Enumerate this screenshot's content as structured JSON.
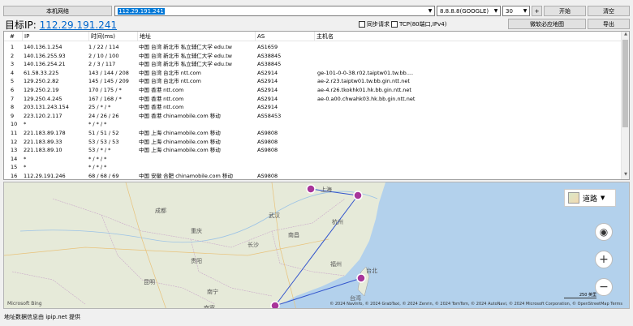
{
  "toolbar": {
    "local_network_label": "本机网络",
    "ip_value": "112.29.191.241",
    "dns_value": "8.8.8.8(GOOGLE)",
    "count_value": "30",
    "plus_label": "+",
    "start_label": "开始",
    "clear_label": "清空",
    "sync_request_label": "同步请求",
    "tcp_label": "TCP(80端口,IPv4)",
    "bing_map_label": "微软必应地图",
    "export_label": "导出"
  },
  "target": {
    "prefix": "目标IP:",
    "ip": "112.29.191.241"
  },
  "table": {
    "headers": [
      "#",
      "IP",
      "时间(ms)",
      "地址",
      "AS",
      "主机名"
    ],
    "rows": [
      [
        "1",
        "140.136.1.254",
        "1 / 22 / 114",
        "中国 台湾 新北市 私立辅仁大学 edu.tw",
        "AS1659",
        ""
      ],
      [
        "2",
        "140.136.255.93",
        "2 / 10 / 100",
        "中国 台湾 新北市 私立辅仁大学 edu.tw",
        "AS38845",
        ""
      ],
      [
        "3",
        "140.136.254.21",
        "2 / 3 / 117",
        "中国 台湾 新北市 私立辅仁大学 edu.tw",
        "AS38845",
        ""
      ],
      [
        "4",
        "61.58.33.225",
        "143 / 144 / 208",
        "中国 台湾 台北市 ntt.com",
        "AS2914",
        "ge-101-0-0-38.r02.taiptw01.tw.bb...."
      ],
      [
        "5",
        "129.250.2.82",
        "145 / 145 / 209",
        "中国 台湾 台北市 ntt.com",
        "AS2914",
        "ae-2.r23.taiptw01.tw.bb.gin.ntt.net"
      ],
      [
        "6",
        "129.250.2.19",
        "170 / 175 / *",
        "中国 香港 ntt.com",
        "AS2914",
        "ae-4.r26.tkokhk01.hk.bb.gin.ntt.net"
      ],
      [
        "7",
        "129.250.4.245",
        "167 / 168 / *",
        "中国 香港 ntt.com",
        "AS2914",
        "ae-0.a00.chwahk03.hk.bb.gin.ntt.net"
      ],
      [
        "8",
        "203.131.243.154",
        "25 / * / *",
        "中国 香港 ntt.com",
        "AS2914",
        ""
      ],
      [
        "9",
        "223.120.2.117",
        "24 / 26 / 26",
        "中国 香港 chinamobile.com 移动",
        "AS58453",
        ""
      ],
      [
        "10",
        "*",
        "* / * / *",
        "",
        "",
        ""
      ],
      [
        "11",
        "221.183.89.178",
        "51 / 51 / 52",
        "中国 上海 chinamobile.com 移动",
        "AS9808",
        ""
      ],
      [
        "12",
        "221.183.89.33",
        "53 / 53 / 53",
        "中国 上海 chinamobile.com 移动",
        "AS9808",
        ""
      ],
      [
        "13",
        "221.183.89.10",
        "53 / * / *",
        "中国 上海 chinamobile.com 移动",
        "AS9808",
        ""
      ],
      [
        "14",
        "*",
        "* / * / *",
        "",
        "",
        ""
      ],
      [
        "15",
        "*",
        "* / * / *",
        "",
        "",
        ""
      ],
      [
        "16",
        "112.29.191.246",
        "68 / 68 / 69",
        "中国 安徽 合肥 chinamobile.com 移动",
        "AS9808",
        ""
      ]
    ]
  },
  "map": {
    "style_label": "道路",
    "labels": [
      "成都",
      "重庆",
      "长沙",
      "南昌",
      "福州",
      "台湾",
      "台北",
      "贵阳",
      "昆明",
      "南宁",
      "南寧",
      "武汉",
      "杭州",
      "上海"
    ],
    "scale_label": "250 英里",
    "copyright": "© 2024 NavInfo, © 2024 GrabTaxi, © 2024 Zenrin, © 2024 TomTom, © 2024 AutoNavi, © 2024 Microsoft Corporation, © OpenStreetMap  Terms",
    "logo": "Microsoft Bing"
  },
  "footer": {
    "text": "地址数据信息由 ipip.net 提供"
  },
  "colors": {
    "link": "#0066cc",
    "route": "#3355cc",
    "marker": "#a8359a"
  }
}
